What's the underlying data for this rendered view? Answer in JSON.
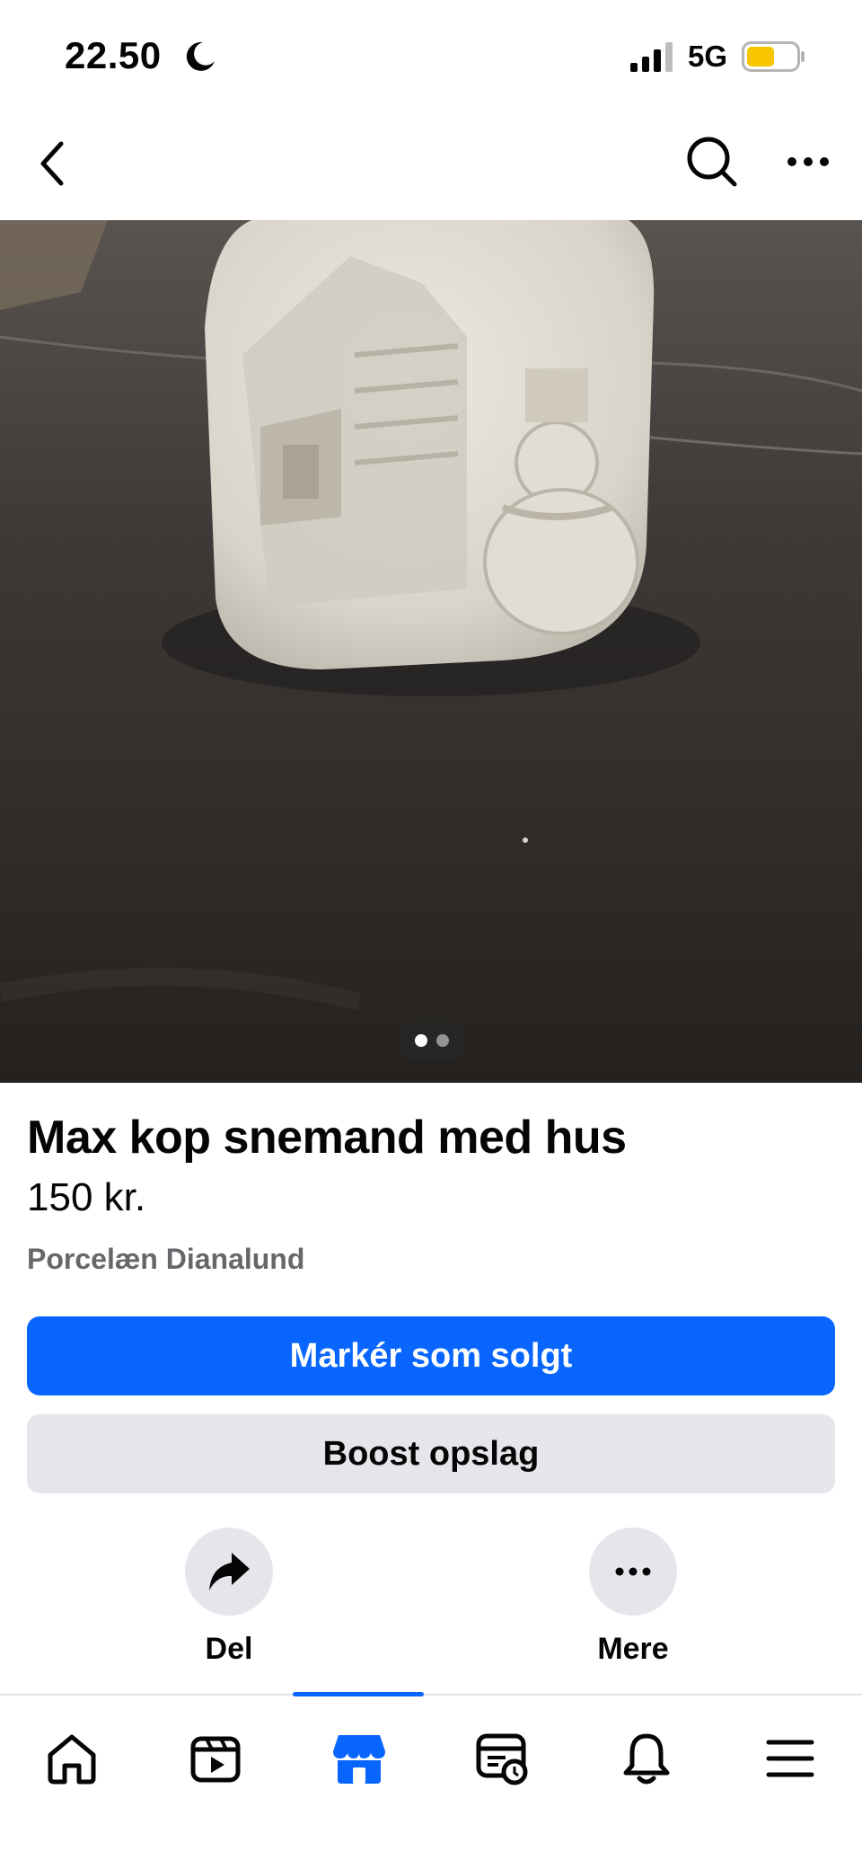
{
  "status_bar": {
    "time": "22.50",
    "network": "5G",
    "icons": [
      "moon-icon",
      "signal-icon",
      "battery-icon"
    ]
  },
  "header": {
    "icons": [
      "back-icon",
      "search-icon",
      "more-horizontal-icon"
    ]
  },
  "photo": {
    "page_count": 2,
    "current_page": 1
  },
  "listing": {
    "title": "Max kop snemand med hus",
    "price": "150 kr.",
    "meta": "Porcelæn Dianalund"
  },
  "buttons": {
    "primary_label": "Markér som solgt",
    "secondary_label": "Boost opslag"
  },
  "actions": [
    {
      "label": "Del",
      "icon": "share-icon"
    },
    {
      "label": "Mere",
      "icon": "more-horizontal-icon"
    }
  ],
  "tab_bar": {
    "tabs": [
      {
        "icon": "home-icon",
        "active": false
      },
      {
        "icon": "video-icon",
        "active": false
      },
      {
        "icon": "marketplace-icon",
        "active": true
      },
      {
        "icon": "feeds-icon",
        "active": false
      },
      {
        "icon": "bell-icon",
        "active": false
      },
      {
        "icon": "menu-icon",
        "active": false
      }
    ]
  },
  "colors": {
    "accent": "#0866ff",
    "secondary_button": "#e4e6eb",
    "meta_text": "#65676b",
    "battery": "#f7c600"
  }
}
